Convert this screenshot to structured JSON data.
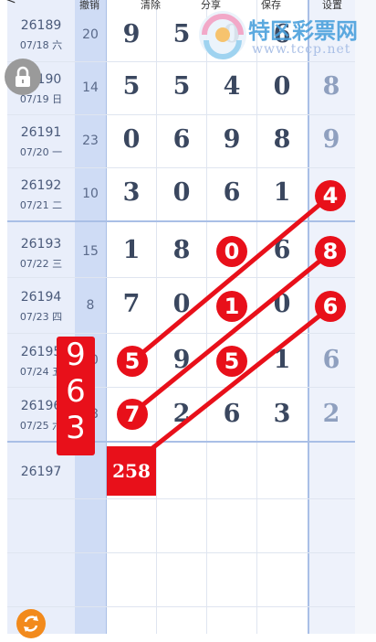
{
  "toolbar": {
    "undo": "撤销",
    "clear": "清除",
    "share": "分享",
    "save": "保存",
    "settings": "设置"
  },
  "logo": {
    "name": "特区彩票网",
    "url": "www.tccp.net"
  },
  "rows": [
    {
      "issue": "26189",
      "date": "07/18 六",
      "sum": "20",
      "digits": [
        "9",
        "5",
        "0",
        "6"
      ],
      "last": ""
    },
    {
      "issue": "26190",
      "date": "07/19 日",
      "sum": "14",
      "digits": [
        "5",
        "5",
        "4",
        "0"
      ],
      "last": "8"
    },
    {
      "issue": "26191",
      "date": "07/20 一",
      "sum": "23",
      "digits": [
        "0",
        "6",
        "9",
        "8"
      ],
      "last": "9"
    },
    {
      "issue": "26192",
      "date": "07/21 二",
      "sum": "10",
      "digits": [
        "3",
        "0",
        "6",
        "1"
      ],
      "last": "4"
    },
    {
      "issue": "26193",
      "date": "07/22 三",
      "sum": "15",
      "digits": [
        "1",
        "8",
        "0",
        "6"
      ],
      "last": "8"
    },
    {
      "issue": "26194",
      "date": "07/23 四",
      "sum": "8",
      "digits": [
        "7",
        "0",
        "1",
        "0"
      ],
      "last": "6"
    },
    {
      "issue": "26195",
      "date": "07/24 五",
      "sum": "20",
      "digits": [
        "5",
        "9",
        "5",
        "1"
      ],
      "last": "6"
    },
    {
      "issue": "26196",
      "date": "07/25 六",
      "sum": "18",
      "digits": [
        "7",
        "2",
        "6",
        "3"
      ],
      "last": "2"
    },
    {
      "issue": "26197",
      "date": "",
      "sum": "",
      "digits": [
        "",
        "",
        "",
        ""
      ],
      "last": ""
    }
  ],
  "balls": [
    "4",
    "0",
    "8",
    "1",
    "6",
    "5",
    "5",
    "7"
  ],
  "side_box": [
    "9",
    "6",
    "3"
  ],
  "result_box": "258"
}
